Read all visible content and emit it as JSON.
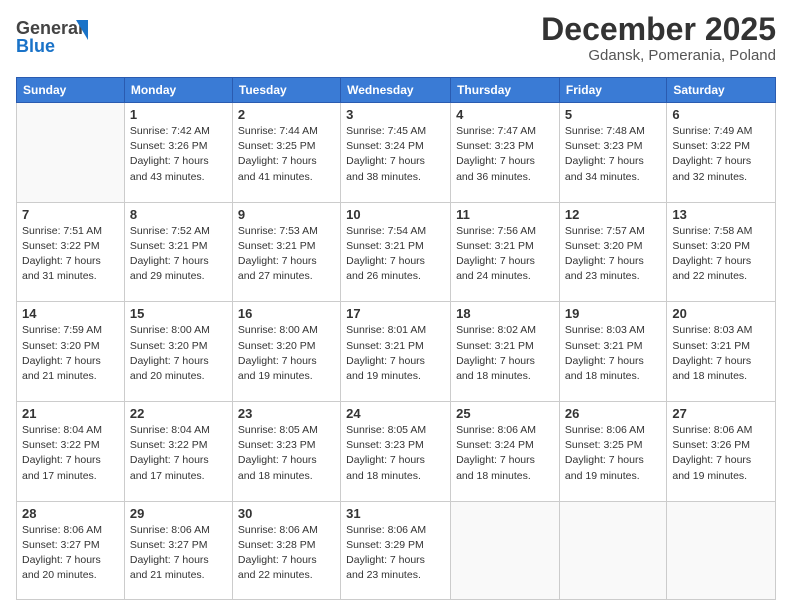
{
  "logo": {
    "line1": "General",
    "line2": "Blue"
  },
  "title": "December 2025",
  "subtitle": "Gdansk, Pomerania, Poland",
  "weekdays": [
    "Sunday",
    "Monday",
    "Tuesday",
    "Wednesday",
    "Thursday",
    "Friday",
    "Saturday"
  ],
  "weeks": [
    [
      {
        "day": "",
        "info": ""
      },
      {
        "day": "1",
        "info": "Sunrise: 7:42 AM\nSunset: 3:26 PM\nDaylight: 7 hours\nand 43 minutes."
      },
      {
        "day": "2",
        "info": "Sunrise: 7:44 AM\nSunset: 3:25 PM\nDaylight: 7 hours\nand 41 minutes."
      },
      {
        "day": "3",
        "info": "Sunrise: 7:45 AM\nSunset: 3:24 PM\nDaylight: 7 hours\nand 38 minutes."
      },
      {
        "day": "4",
        "info": "Sunrise: 7:47 AM\nSunset: 3:23 PM\nDaylight: 7 hours\nand 36 minutes."
      },
      {
        "day": "5",
        "info": "Sunrise: 7:48 AM\nSunset: 3:23 PM\nDaylight: 7 hours\nand 34 minutes."
      },
      {
        "day": "6",
        "info": "Sunrise: 7:49 AM\nSunset: 3:22 PM\nDaylight: 7 hours\nand 32 minutes."
      }
    ],
    [
      {
        "day": "7",
        "info": "Sunrise: 7:51 AM\nSunset: 3:22 PM\nDaylight: 7 hours\nand 31 minutes."
      },
      {
        "day": "8",
        "info": "Sunrise: 7:52 AM\nSunset: 3:21 PM\nDaylight: 7 hours\nand 29 minutes."
      },
      {
        "day": "9",
        "info": "Sunrise: 7:53 AM\nSunset: 3:21 PM\nDaylight: 7 hours\nand 27 minutes."
      },
      {
        "day": "10",
        "info": "Sunrise: 7:54 AM\nSunset: 3:21 PM\nDaylight: 7 hours\nand 26 minutes."
      },
      {
        "day": "11",
        "info": "Sunrise: 7:56 AM\nSunset: 3:21 PM\nDaylight: 7 hours\nand 24 minutes."
      },
      {
        "day": "12",
        "info": "Sunrise: 7:57 AM\nSunset: 3:20 PM\nDaylight: 7 hours\nand 23 minutes."
      },
      {
        "day": "13",
        "info": "Sunrise: 7:58 AM\nSunset: 3:20 PM\nDaylight: 7 hours\nand 22 minutes."
      }
    ],
    [
      {
        "day": "14",
        "info": "Sunrise: 7:59 AM\nSunset: 3:20 PM\nDaylight: 7 hours\nand 21 minutes."
      },
      {
        "day": "15",
        "info": "Sunrise: 8:00 AM\nSunset: 3:20 PM\nDaylight: 7 hours\nand 20 minutes."
      },
      {
        "day": "16",
        "info": "Sunrise: 8:00 AM\nSunset: 3:20 PM\nDaylight: 7 hours\nand 19 minutes."
      },
      {
        "day": "17",
        "info": "Sunrise: 8:01 AM\nSunset: 3:21 PM\nDaylight: 7 hours\nand 19 minutes."
      },
      {
        "day": "18",
        "info": "Sunrise: 8:02 AM\nSunset: 3:21 PM\nDaylight: 7 hours\nand 18 minutes."
      },
      {
        "day": "19",
        "info": "Sunrise: 8:03 AM\nSunset: 3:21 PM\nDaylight: 7 hours\nand 18 minutes."
      },
      {
        "day": "20",
        "info": "Sunrise: 8:03 AM\nSunset: 3:21 PM\nDaylight: 7 hours\nand 18 minutes."
      }
    ],
    [
      {
        "day": "21",
        "info": "Sunrise: 8:04 AM\nSunset: 3:22 PM\nDaylight: 7 hours\nand 17 minutes."
      },
      {
        "day": "22",
        "info": "Sunrise: 8:04 AM\nSunset: 3:22 PM\nDaylight: 7 hours\nand 17 minutes."
      },
      {
        "day": "23",
        "info": "Sunrise: 8:05 AM\nSunset: 3:23 PM\nDaylight: 7 hours\nand 18 minutes."
      },
      {
        "day": "24",
        "info": "Sunrise: 8:05 AM\nSunset: 3:23 PM\nDaylight: 7 hours\nand 18 minutes."
      },
      {
        "day": "25",
        "info": "Sunrise: 8:06 AM\nSunset: 3:24 PM\nDaylight: 7 hours\nand 18 minutes."
      },
      {
        "day": "26",
        "info": "Sunrise: 8:06 AM\nSunset: 3:25 PM\nDaylight: 7 hours\nand 19 minutes."
      },
      {
        "day": "27",
        "info": "Sunrise: 8:06 AM\nSunset: 3:26 PM\nDaylight: 7 hours\nand 19 minutes."
      }
    ],
    [
      {
        "day": "28",
        "info": "Sunrise: 8:06 AM\nSunset: 3:27 PM\nDaylight: 7 hours\nand 20 minutes."
      },
      {
        "day": "29",
        "info": "Sunrise: 8:06 AM\nSunset: 3:27 PM\nDaylight: 7 hours\nand 21 minutes."
      },
      {
        "day": "30",
        "info": "Sunrise: 8:06 AM\nSunset: 3:28 PM\nDaylight: 7 hours\nand 22 minutes."
      },
      {
        "day": "31",
        "info": "Sunrise: 8:06 AM\nSunset: 3:29 PM\nDaylight: 7 hours\nand 23 minutes."
      },
      {
        "day": "",
        "info": ""
      },
      {
        "day": "",
        "info": ""
      },
      {
        "day": "",
        "info": ""
      }
    ]
  ]
}
